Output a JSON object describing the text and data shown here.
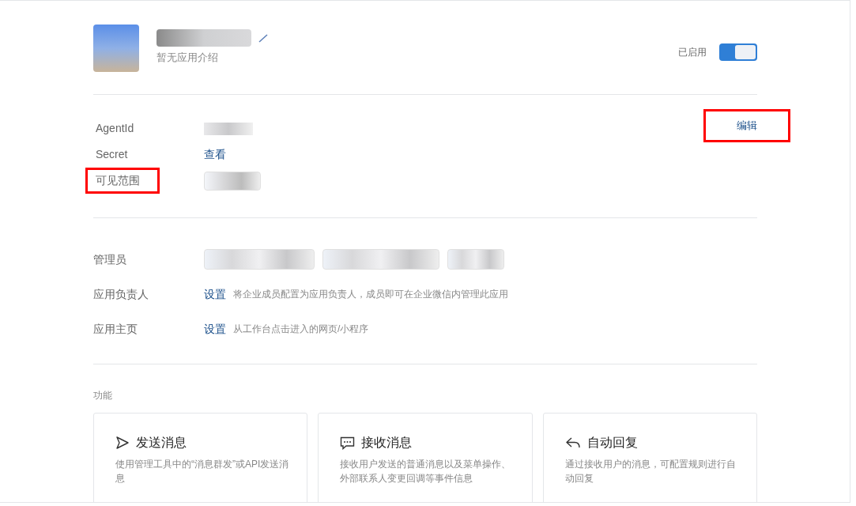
{
  "app": {
    "name_redacted": true,
    "description": "暂无应用介绍",
    "status_label": "已启用",
    "enabled": true
  },
  "info": {
    "edit_button": {
      "label": "编辑",
      "highlighted": true
    },
    "rows": [
      {
        "kind": "redacted",
        "label": "AgentId",
        "highlighted": false
      },
      {
        "kind": "link",
        "label": "Secret",
        "value": "查看",
        "highlighted": false
      },
      {
        "kind": "tag",
        "label": "可见范围",
        "highlighted": true
      }
    ]
  },
  "people": [
    {
      "kind": "tags",
      "label": "管理员",
      "tags": [
        {
          "redacted": true
        },
        {
          "redacted": true
        },
        {
          "redacted": true
        }
      ]
    },
    {
      "kind": "setting",
      "label": "应用负责人",
      "link": "设置",
      "hint": "将企业成员配置为应用负责人，成员即可在企业微信内管理此应用"
    },
    {
      "kind": "setting",
      "label": "应用主页",
      "link": "设置",
      "hint": "从工作台点击进入的网页/小程序"
    }
  ],
  "features": {
    "title": "功能",
    "cards": [
      {
        "kind": "send",
        "title": "发送消息",
        "description": "使用管理工具中的“消息群发”或API发送消息"
      },
      {
        "kind": "receive",
        "title": "接收消息",
        "description": "接收用户发送的普通消息以及菜单操作、外部联系人变更回调等事件信息"
      },
      {
        "kind": "reply",
        "title": "自动回复",
        "description": "通过接收用户的消息，可配置规则进行自动回复"
      }
    ]
  }
}
